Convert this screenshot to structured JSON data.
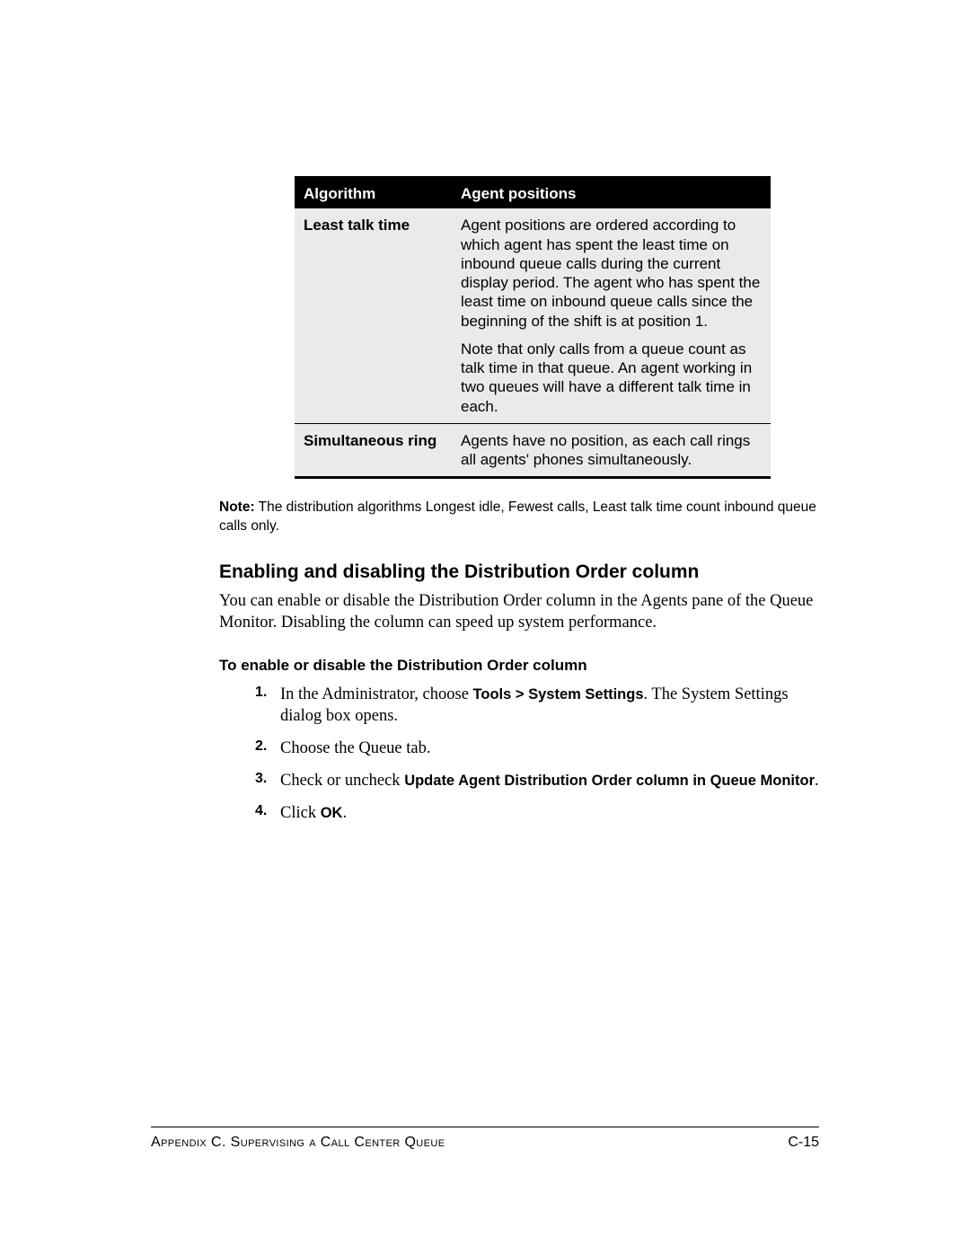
{
  "table": {
    "headers": {
      "algorithm": "Algorithm",
      "positions": "Agent positions"
    },
    "rows": [
      {
        "algorithm": "Least talk time",
        "paras": [
          "Agent positions are ordered according to which agent has spent the least time on inbound queue calls during the current display period. The agent who has spent the least time on inbound queue calls since the beginning of the shift is at position 1.",
          "Note that only calls from a queue count as talk time in that queue. An agent working in two queues will have a different talk time in each."
        ]
      },
      {
        "algorithm": "Simultaneous ring",
        "paras": [
          "Agents have no position, as each call rings all agents' phones simultaneously."
        ]
      }
    ]
  },
  "note": {
    "label": "Note:",
    "text": "The distribution algorithms Longest idle, Fewest calls, Least talk time count inbound queue calls only."
  },
  "section": {
    "heading": "Enabling and disabling the Distribution Order column",
    "body": "You can enable or disable the Distribution Order column in the Agents pane of the Queue Monitor. Disabling the column can speed up system performance.",
    "subheading": "To enable or disable the Distribution Order column"
  },
  "steps": {
    "s1a": "In the Administrator, choose ",
    "s1b": "Tools > System Settings",
    "s1c": ". The System Settings dialog box opens.",
    "s2": "Choose the Queue tab.",
    "s3a": "Check or uncheck ",
    "s3b": "Update Agent Distribution Order column in Queue Monitor",
    "s3c": ".",
    "s4a": "Click ",
    "s4b": "OK",
    "s4c": "."
  },
  "footer": {
    "appendix": "Appendix C. Supervising a Call Center Queue",
    "page": "C-15"
  }
}
